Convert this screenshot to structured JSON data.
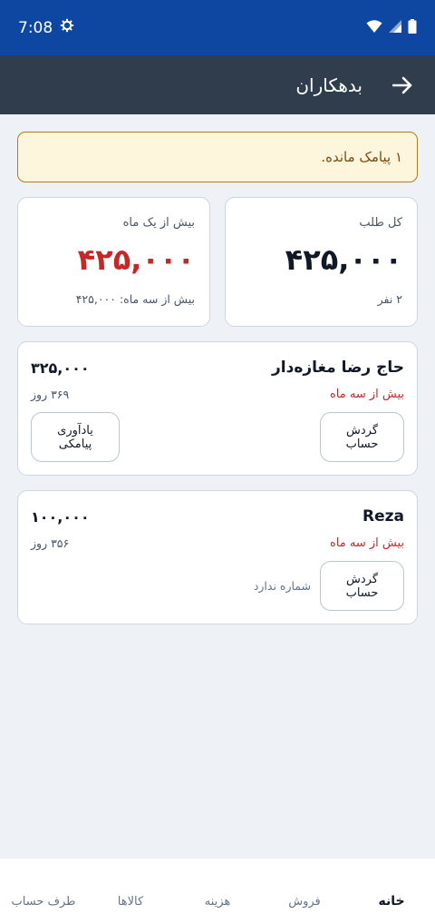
{
  "status": {
    "time": "7:08"
  },
  "header": {
    "title": "بدهکاران"
  },
  "alert": {
    "text": "۱ پیامک مانده."
  },
  "summary": {
    "total": {
      "label": "کل طلب",
      "value": "۴۲۵,۰۰۰",
      "sub": "۲ نفر"
    },
    "over_month": {
      "label": "بیش از یک ماه",
      "value": "۴۲۵,۰۰۰",
      "sub": "بیش از سه ماه: ۴۲۵,۰۰۰"
    }
  },
  "debtors": [
    {
      "name": "حاج رضا مغازه‌دار",
      "amount": "۳۲۵,۰۰۰",
      "overdue": "بیش از سه ماه",
      "days": "۳۶۹ روز",
      "account_btn": "گردش حساب",
      "remind_btn": "یادآوری پیامکی"
    },
    {
      "name": "Reza",
      "amount": "۱۰۰,۰۰۰",
      "overdue": "بیش از سه ماه",
      "days": "۳۵۶ روز",
      "account_btn": "گردش حساب",
      "no_phone": "شماره ندارد"
    }
  ],
  "nav": [
    {
      "label": "خانه"
    },
    {
      "label": "فروش"
    },
    {
      "label": "هزینه"
    },
    {
      "label": "کالاها"
    },
    {
      "label": "طرف حساب"
    }
  ],
  "colors": {
    "status_bar": "#0d47a1",
    "app_bar": "#2f3d4c",
    "accent_red": "#c62828",
    "alert_border": "#b7791f"
  },
  "icons": {
    "back": "arrow-right-icon",
    "gear": "gear-icon",
    "wifi": "wifi-icon",
    "signal": "signal-icon",
    "battery": "battery-icon"
  }
}
